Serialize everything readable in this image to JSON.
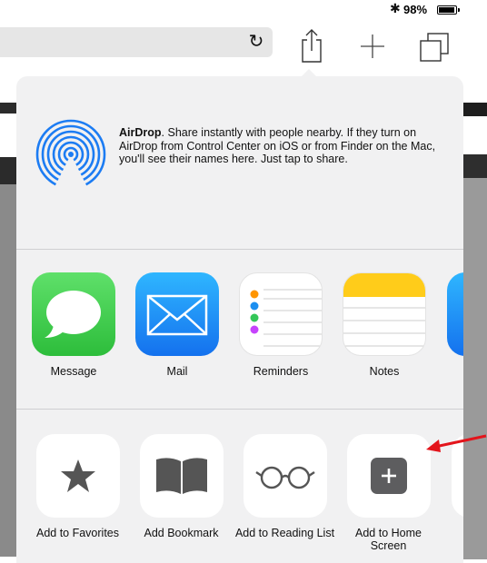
{
  "status_bar": {
    "bluetooth": "✱",
    "battery_pct": "98%",
    "battery_level": 0.98
  },
  "toolbar": {
    "reload_icon": "reload-icon",
    "share_icon": "share-icon",
    "new_tab_icon": "plus-icon",
    "tabs_icon": "tabs-icon"
  },
  "airdrop": {
    "title": "AirDrop",
    "description": ". Share instantly with people nearby. If they turn on AirDrop from Control Center on iOS or from Finder on the Mac, you'll see their names here. Just tap to share."
  },
  "apps": [
    {
      "label": "Message",
      "icon": "message-icon"
    },
    {
      "label": "Mail",
      "icon": "mail-icon"
    },
    {
      "label": "Reminders",
      "icon": "reminders-icon"
    },
    {
      "label": "Notes",
      "icon": "notes-icon"
    }
  ],
  "actions": [
    {
      "label": "Add to Favorites",
      "icon": "star-icon"
    },
    {
      "label": "Add Bookmark",
      "icon": "book-icon"
    },
    {
      "label": "Add to Reading List",
      "icon": "glasses-icon"
    },
    {
      "label": "Add to Home Screen",
      "icon": "add-square-icon"
    }
  ],
  "colors": {
    "sheet_bg": "#f1f1f2",
    "arrow": "#e3141b",
    "message_green": "#2dbd3b",
    "mail_blue": "#1471ee",
    "notes_yellow": "#ffcc1a"
  }
}
